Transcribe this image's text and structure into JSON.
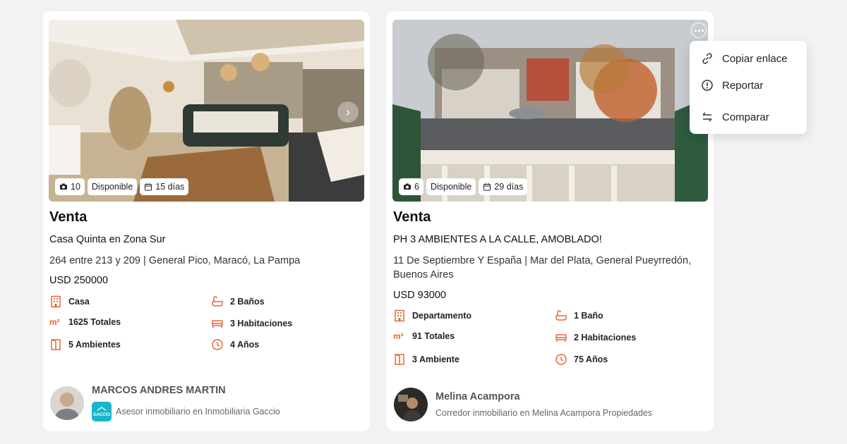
{
  "listings": [
    {
      "photo_count": "10",
      "status": "Disponible",
      "age": "15 días",
      "operation": "Venta",
      "title": "Casa Quinta en Zona Sur",
      "address": "264 entre 213 y 209 | General Pico, Maracó, La Pampa",
      "price": "USD 250000",
      "features": {
        "type": "Casa",
        "bathrooms": "2 Baños",
        "area": "1625 Totales",
        "bedrooms": "3 Habitaciones",
        "rooms": "5 Ambientes",
        "years": "4 Años"
      },
      "agent": {
        "name": "MARCOS ANDRES MARTIN",
        "role": "Asesor inmobiliario en Inmobiliaria Gaccio",
        "agency_logo_text": "GACCIO"
      }
    },
    {
      "photo_count": "6",
      "status": "Disponible",
      "age": "29 días",
      "operation": "Venta",
      "title": "PH 3 AMBIENTES A LA CALLE, AMOBLADO!",
      "address": "11 De Septiembre Y España | Mar del Plata, General Pueyrredón, Buenos Aires",
      "price": "USD 93000",
      "features": {
        "type": "Departamento",
        "bathrooms": "1 Baño",
        "area": "91 Totales",
        "bedrooms": "2 Habitaciones",
        "rooms": "3 Ambiente",
        "years": "75 Años"
      },
      "agent": {
        "name": "Melina Acampora",
        "role": "Corredor inmobiliario en Melina Acampora Propiedades"
      }
    }
  ],
  "context_menu": {
    "copy_link": "Copiar enlace",
    "report": "Reportar",
    "compare": "Comparar"
  },
  "icons": {
    "area_unit": "m²"
  },
  "colors": {
    "accent": "#e8653c",
    "agency": "#19b6c9",
    "background": "#f2f2f2"
  }
}
